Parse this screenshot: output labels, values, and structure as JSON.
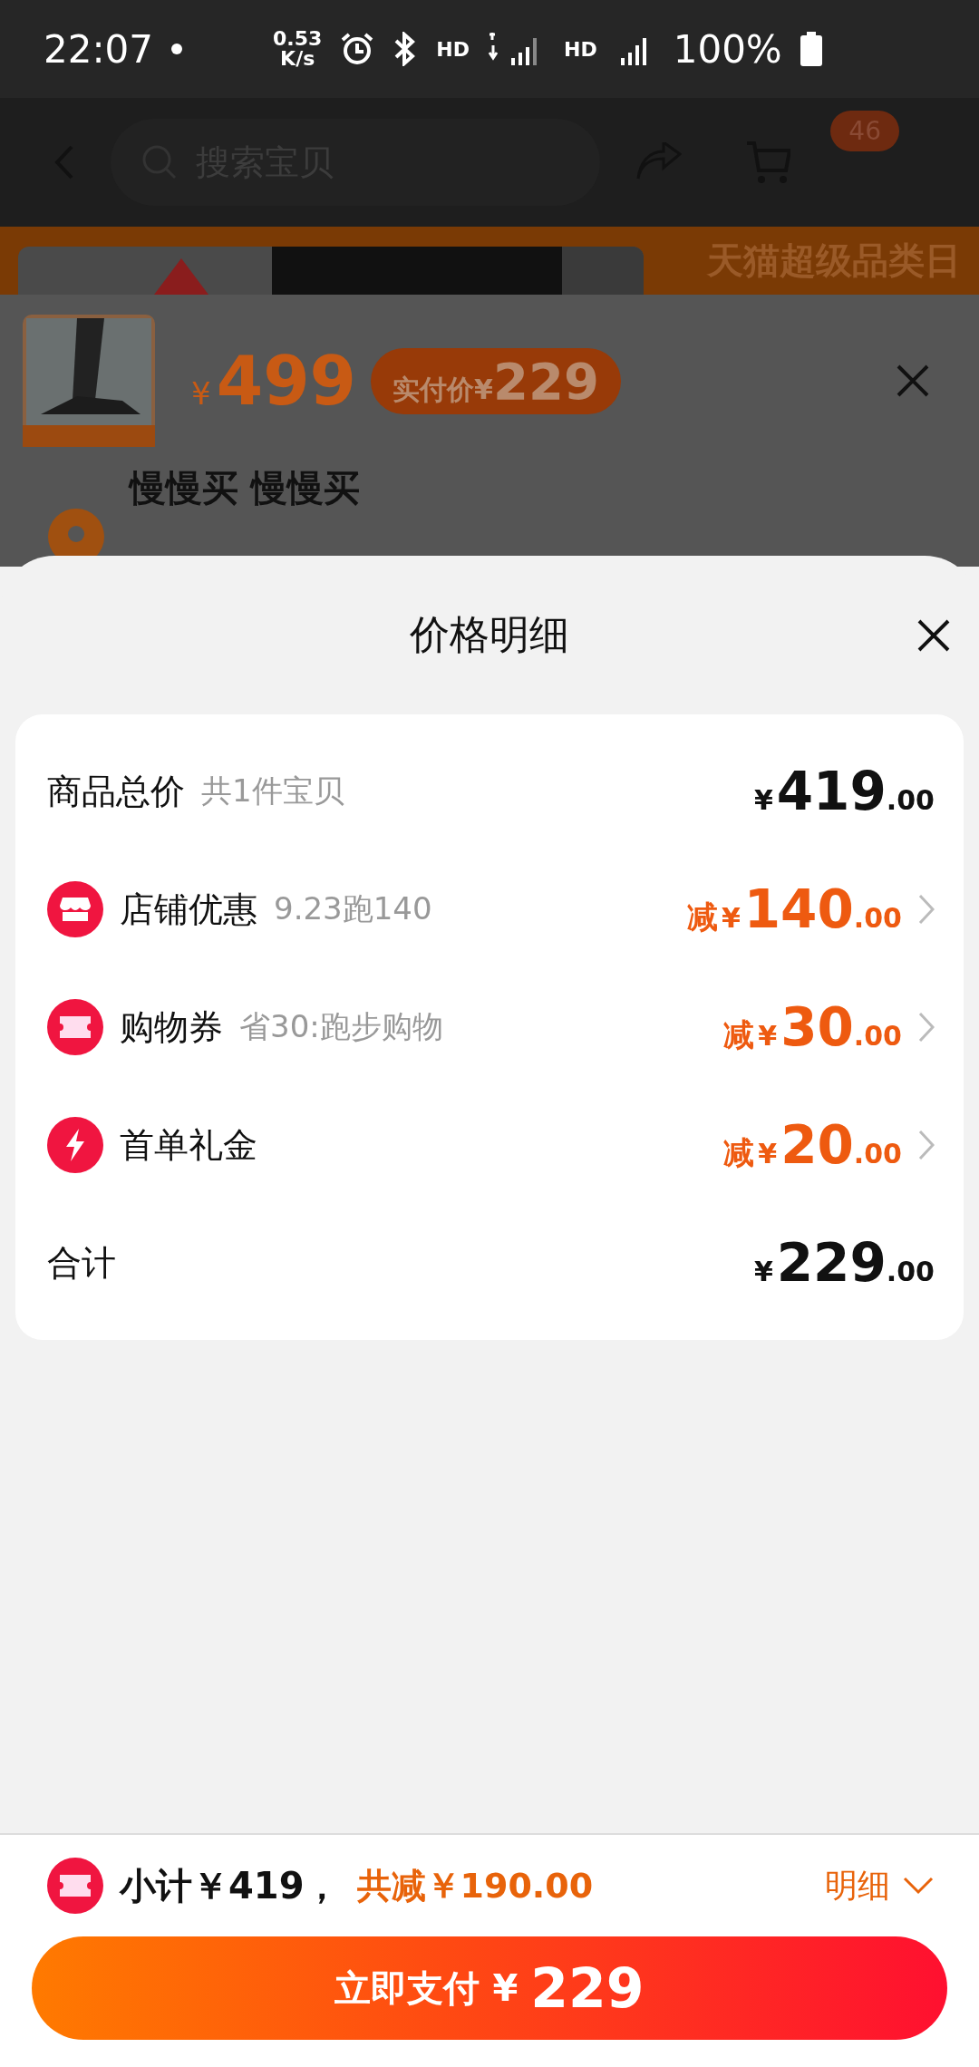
{
  "status_bar": {
    "time": "22:07",
    "speed_value": "0.53",
    "speed_unit": "K/s",
    "network_1": "HD",
    "network_2": "HD",
    "battery": "100%"
  },
  "header": {
    "search_placeholder": "搜索宝贝",
    "cart_badge": "46"
  },
  "banner": {
    "text": "天猫超级品类日"
  },
  "product": {
    "kind": "picture",
    "price_symbol": "¥",
    "price": "499",
    "actual_label": "实付价",
    "actual_symbol": "¥",
    "actual_price": "229",
    "address_name": "慢慢买 慢慢买"
  },
  "sheet": {
    "title": "价格明细",
    "rows": [
      {
        "kind": "total",
        "label": "商品总价",
        "note": "共1件宝贝",
        "symbol": "¥",
        "amount": "419",
        "decimals": ".00"
      },
      {
        "kind": "discount",
        "label": "店铺优惠",
        "note": "9.23跑140",
        "prefix": "减",
        "symbol": "¥",
        "amount": "140",
        "decimals": ".00"
      },
      {
        "kind": "discount",
        "label": "购物券",
        "note": "省30:跑步购物",
        "prefix": "减",
        "symbol": "¥",
        "amount": "30",
        "decimals": ".00"
      },
      {
        "kind": "discount",
        "label": "首单礼金",
        "prefix": "减",
        "symbol": "¥",
        "amount": "20",
        "decimals": ".00"
      },
      {
        "kind": "total",
        "label": "合计",
        "symbol": "¥",
        "amount": "229",
        "decimals": ".00"
      }
    ]
  },
  "footer": {
    "subtotal": "小计￥419，",
    "saved": "共减￥190.00",
    "detail": "明细",
    "pay_label": "立即支付",
    "pay_symbol": "¥",
    "pay_amount": "229"
  }
}
